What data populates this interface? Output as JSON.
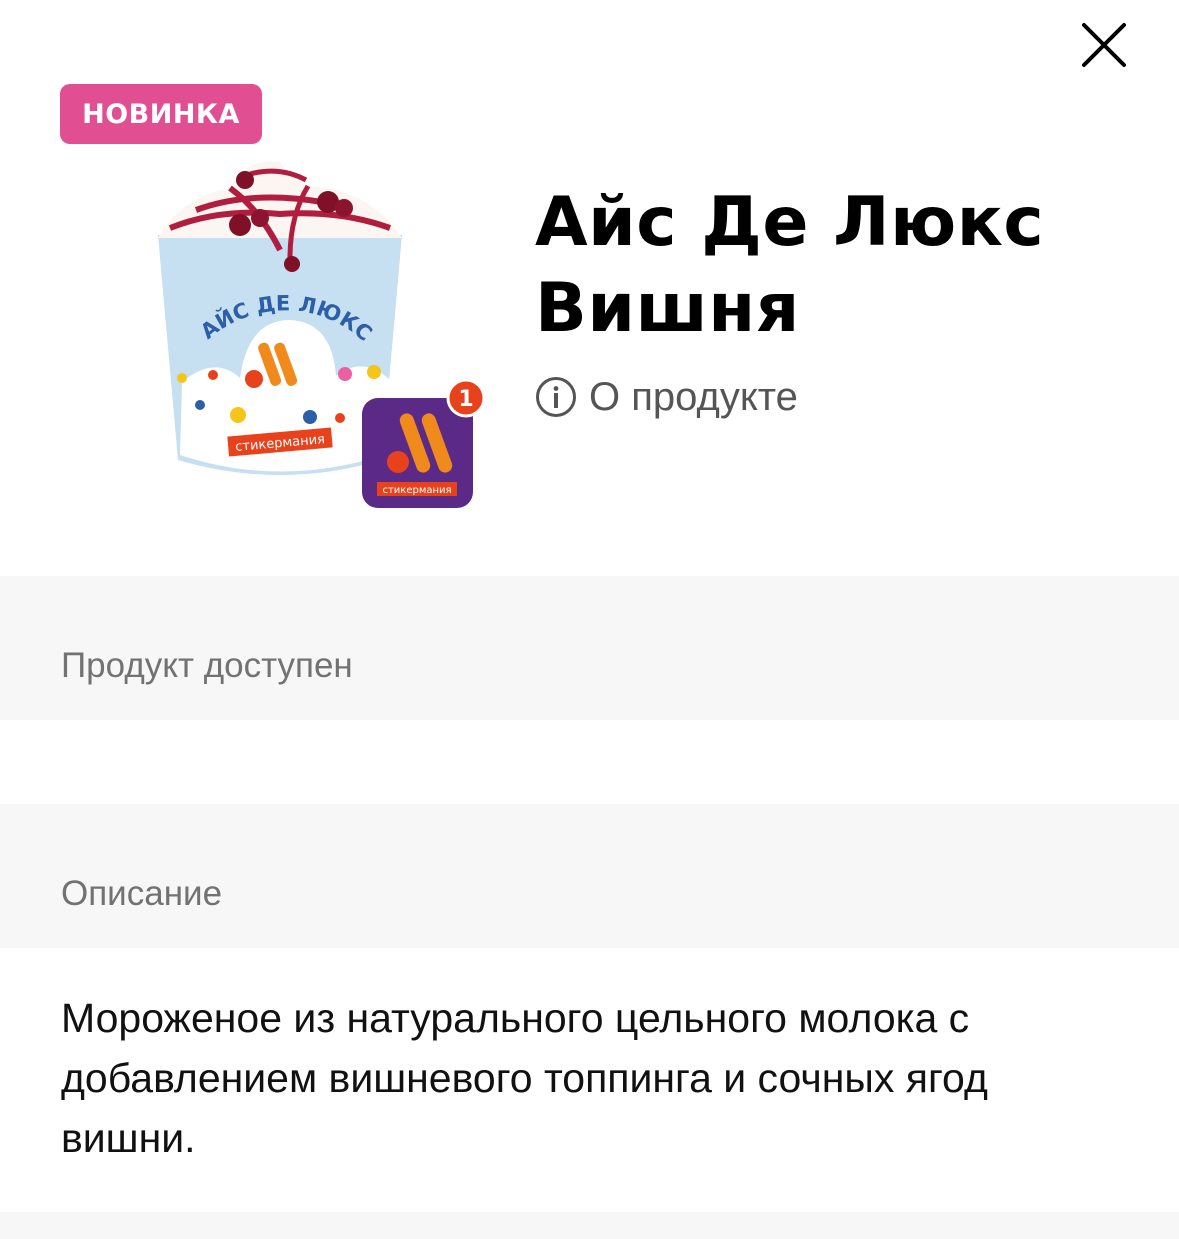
{
  "header": {
    "close_icon": "close-icon",
    "badge_label": "НОВИНКА",
    "badge_color": "#e14f92"
  },
  "product": {
    "image_icon": "ice-cream-cup-image",
    "cup_text": "АЙС ДЕ ЛЮКС",
    "cup_logo_text": "стикермания",
    "sticker_icon": "sticker-icon",
    "sticker_label": "стикермания",
    "sticker_count": "1",
    "sticker_color": "#5b2a86",
    "title_line1": "Айс Де Люкс",
    "title_line2": "Вишня",
    "info_icon": "info-icon",
    "info_label": "О продукте"
  },
  "availability": {
    "header": "Продукт доступен"
  },
  "description": {
    "header": "Описание",
    "text": "Мороженое из натурального цельного молока с добавлением вишневого топпинга и сочных ягод вишни."
  }
}
